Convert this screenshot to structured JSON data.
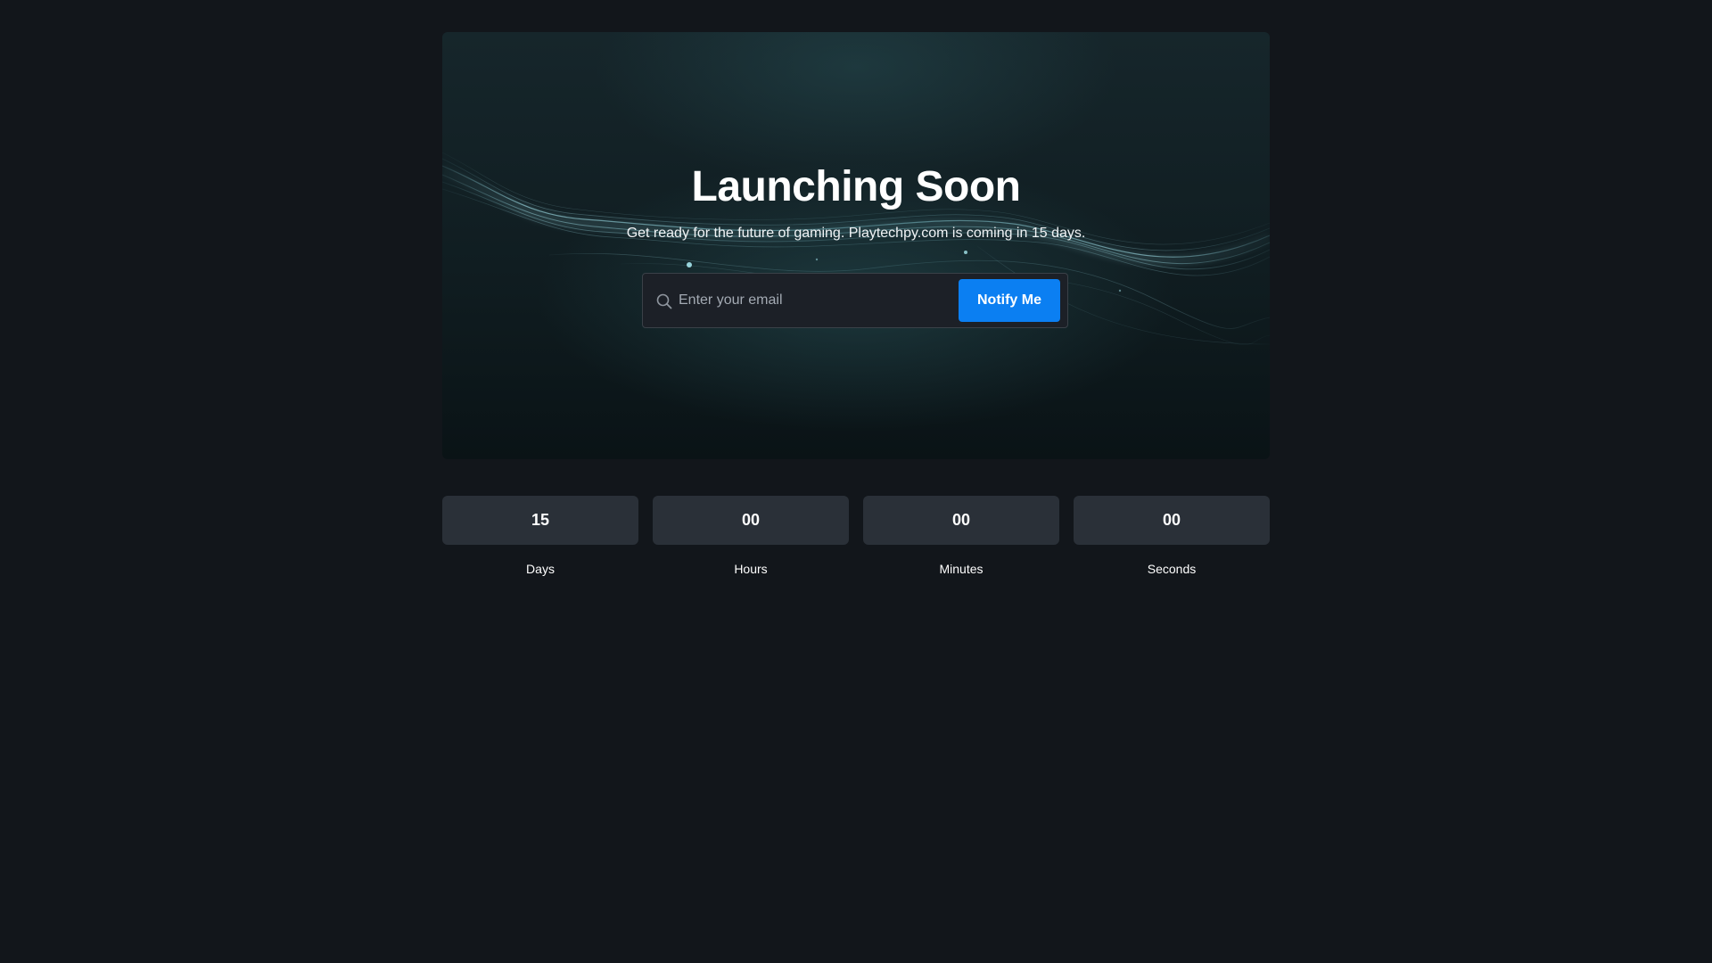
{
  "hero": {
    "title": "Launching Soon",
    "subtitle": "Get ready for the future of gaming. Playtechpy.com is coming in 15 days.",
    "email_placeholder": "Enter your email",
    "email_value": "",
    "notify_label": "Notify Me",
    "search_icon": "search-icon"
  },
  "countdown": {
    "days": {
      "value": "15",
      "label": "Days"
    },
    "hours": {
      "value": "00",
      "label": "Hours"
    },
    "minutes": {
      "value": "00",
      "label": "Minutes"
    },
    "seconds": {
      "value": "00",
      "label": "Seconds"
    }
  },
  "colors": {
    "page_background": "#12161b",
    "accent": "#0b7ff2",
    "countdown_box": "#2a3038",
    "input_background": "#1c2027"
  }
}
